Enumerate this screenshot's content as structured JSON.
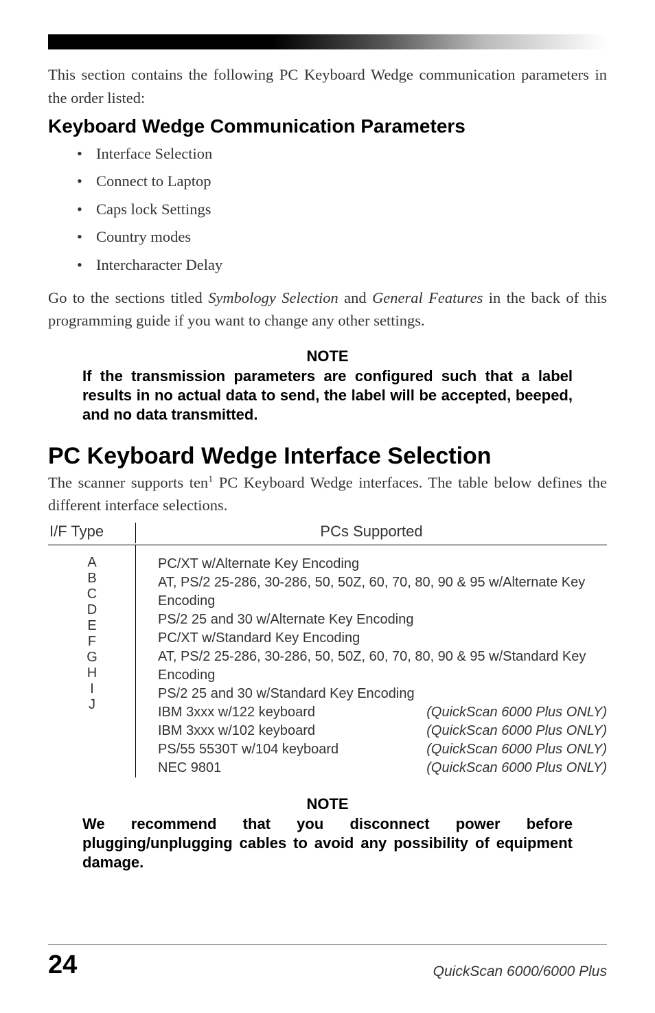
{
  "intro": "This section contains the following PC Keyboard Wedge communication parameters in the order listed:",
  "h2_params": "Keyboard Wedge Communication Parameters",
  "bullets": [
    "Interface Selection",
    "Connect to Laptop",
    "Caps lock Settings",
    "Country modes",
    "Intercharacter Delay"
  ],
  "goto_pre": "Go to the sections titled ",
  "goto_sym": "Symbology Selection",
  "goto_and": " and ",
  "goto_gen": "General Features",
  "goto_post": " in the back of this programming guide if you want to change any other settings.",
  "note1": {
    "title": "NOTE",
    "body": "If the transmission parameters are configured such that a label results in no actual data to send, the label will be accepted, beeped, and no data transmitted."
  },
  "h1_sel": "PC Keyboard Wedge Interface Selection",
  "scanner_pre": "The scanner supports ten",
  "scanner_sup": "1",
  "scanner_post": " PC Keyboard Wedge interfaces. The table below defines the different interface selections.",
  "table": {
    "head_type": "I/F Type",
    "head_pcs": "PCs Supported",
    "rows": [
      {
        "t": "A",
        "d": "PC/XT w/Alternate Key Encoding",
        "r": ""
      },
      {
        "t": "B",
        "d": "AT, PS/2 25-286, 30-286, 50, 50Z, 60, 70, 80, 90 & 95 w/Alternate Key Encoding",
        "r": ""
      },
      {
        "t": "C",
        "d": "PS/2 25 and 30 w/Alternate Key Encoding",
        "r": ""
      },
      {
        "t": "D",
        "d": "PC/XT w/Standard Key Encoding",
        "r": ""
      },
      {
        "t": "E",
        "d": "AT, PS/2 25-286, 30-286, 50, 50Z, 60, 70, 80, 90 & 95 w/Standard Key Encoding",
        "r": ""
      },
      {
        "t": "F",
        "d": "PS/2 25 and 30 w/Standard Key Encoding",
        "r": ""
      },
      {
        "t": "G",
        "d": "IBM 3xxx w/122 keyboard",
        "r": "(QuickScan 6000 Plus ONLY)"
      },
      {
        "t": "H",
        "d": "IBM 3xxx w/102 keyboard",
        "r": "(QuickScan 6000 Plus ONLY)"
      },
      {
        "t": "I",
        "d": "PS/55 5530T w/104 keyboard",
        "r": "(QuickScan 6000 Plus ONLY)"
      },
      {
        "t": "J",
        "d": "NEC 9801",
        "r": "(QuickScan 6000 Plus ONLY)"
      }
    ]
  },
  "note2": {
    "title": "NOTE",
    "body": "We recommend that you disconnect power before plugging/unplugging cables to avoid any possibility of equipment damage."
  },
  "footer": {
    "page": "24",
    "title": "QuickScan 6000/6000 Plus"
  }
}
